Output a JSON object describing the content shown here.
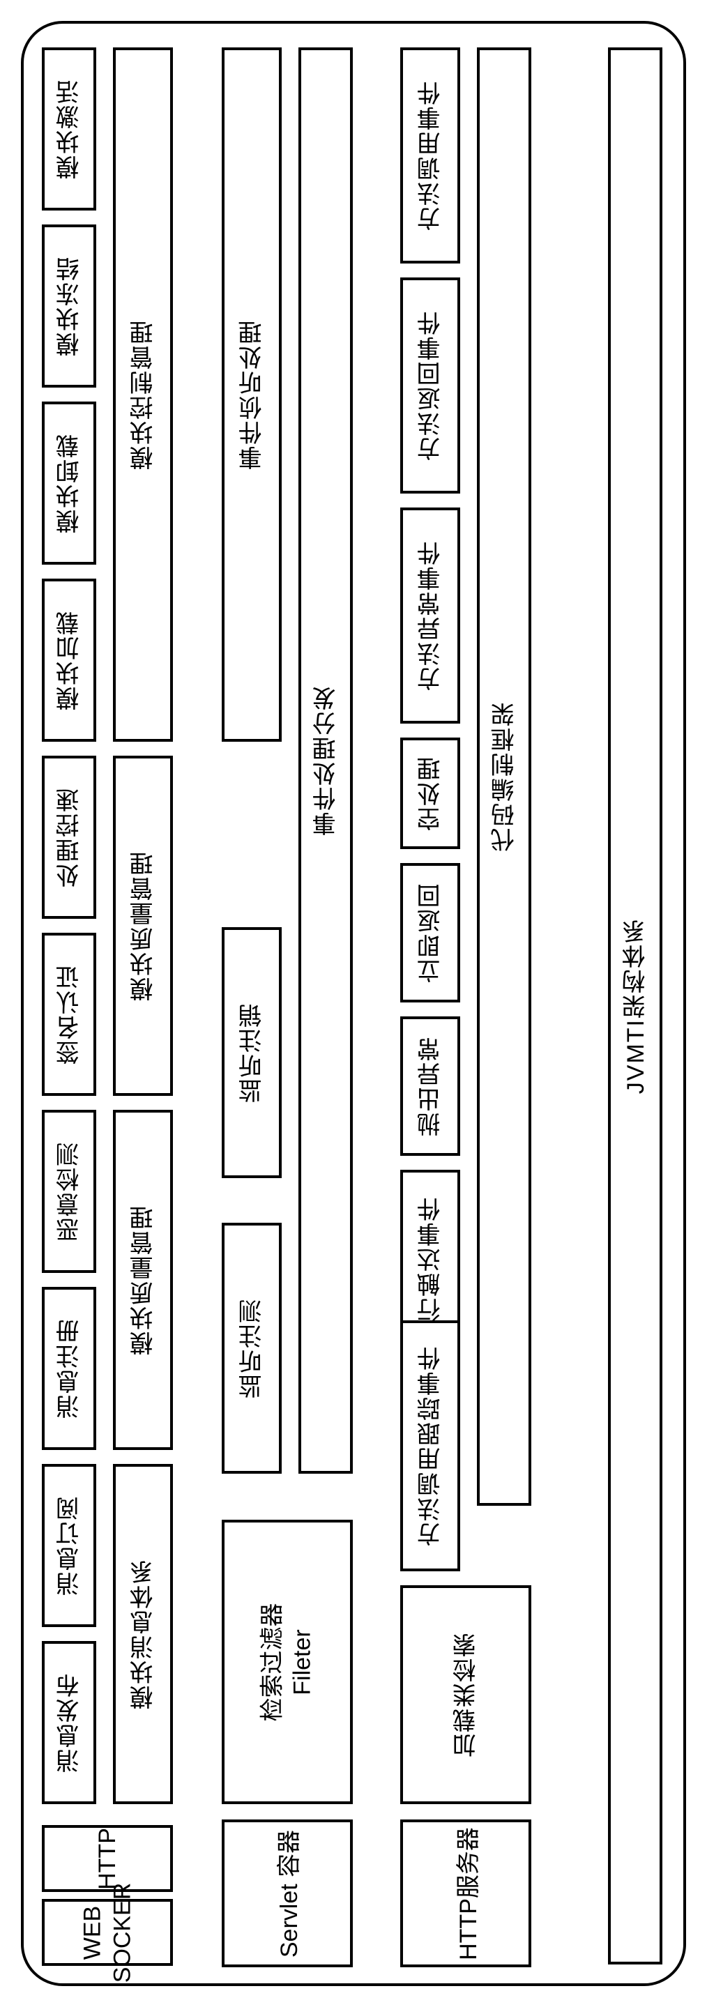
{
  "rows": {
    "r1": {
      "c1": "模块激活",
      "c2": "模块冻结",
      "c3": "模块卸载",
      "c4": "模块加载",
      "c5": "处理控速",
      "c6": "签名认证",
      "c7": "恶意检测",
      "c8": "消息注册",
      "c9": "消息订阅",
      "c10": "消息发布",
      "c11": "HTTP",
      "c12_line1": "WEB",
      "c12_line2": "SOCKER"
    },
    "r2": {
      "c1": "模块控制管理",
      "c2": "模块质量管理",
      "c3": "模块质量管理",
      "c4": "模块消息体系"
    },
    "r3": {
      "c1": "事件侦听处理",
      "c2": "监听注销",
      "c3": "监听注测",
      "c4_line1": "检索过滤器",
      "c4_line2": "Fileter",
      "right": "Servlet 容器"
    },
    "r4": {
      "c1": "事件处理分发"
    },
    "r5": {
      "c1": "方法调用事件",
      "c2": "方法返回事件",
      "c3": "方法异常事件",
      "c4": "空处理",
      "c5": "立即返回",
      "c6": "抛出异常",
      "c7": "方法内代码行触达事件",
      "c8": "方法调用跟踪事件",
      "c9": "加载类检索",
      "right": "HTTP服务器"
    },
    "r6": {
      "c1": "代码编制框架"
    },
    "r7": {
      "c1": "JVMTI架构体系"
    }
  }
}
